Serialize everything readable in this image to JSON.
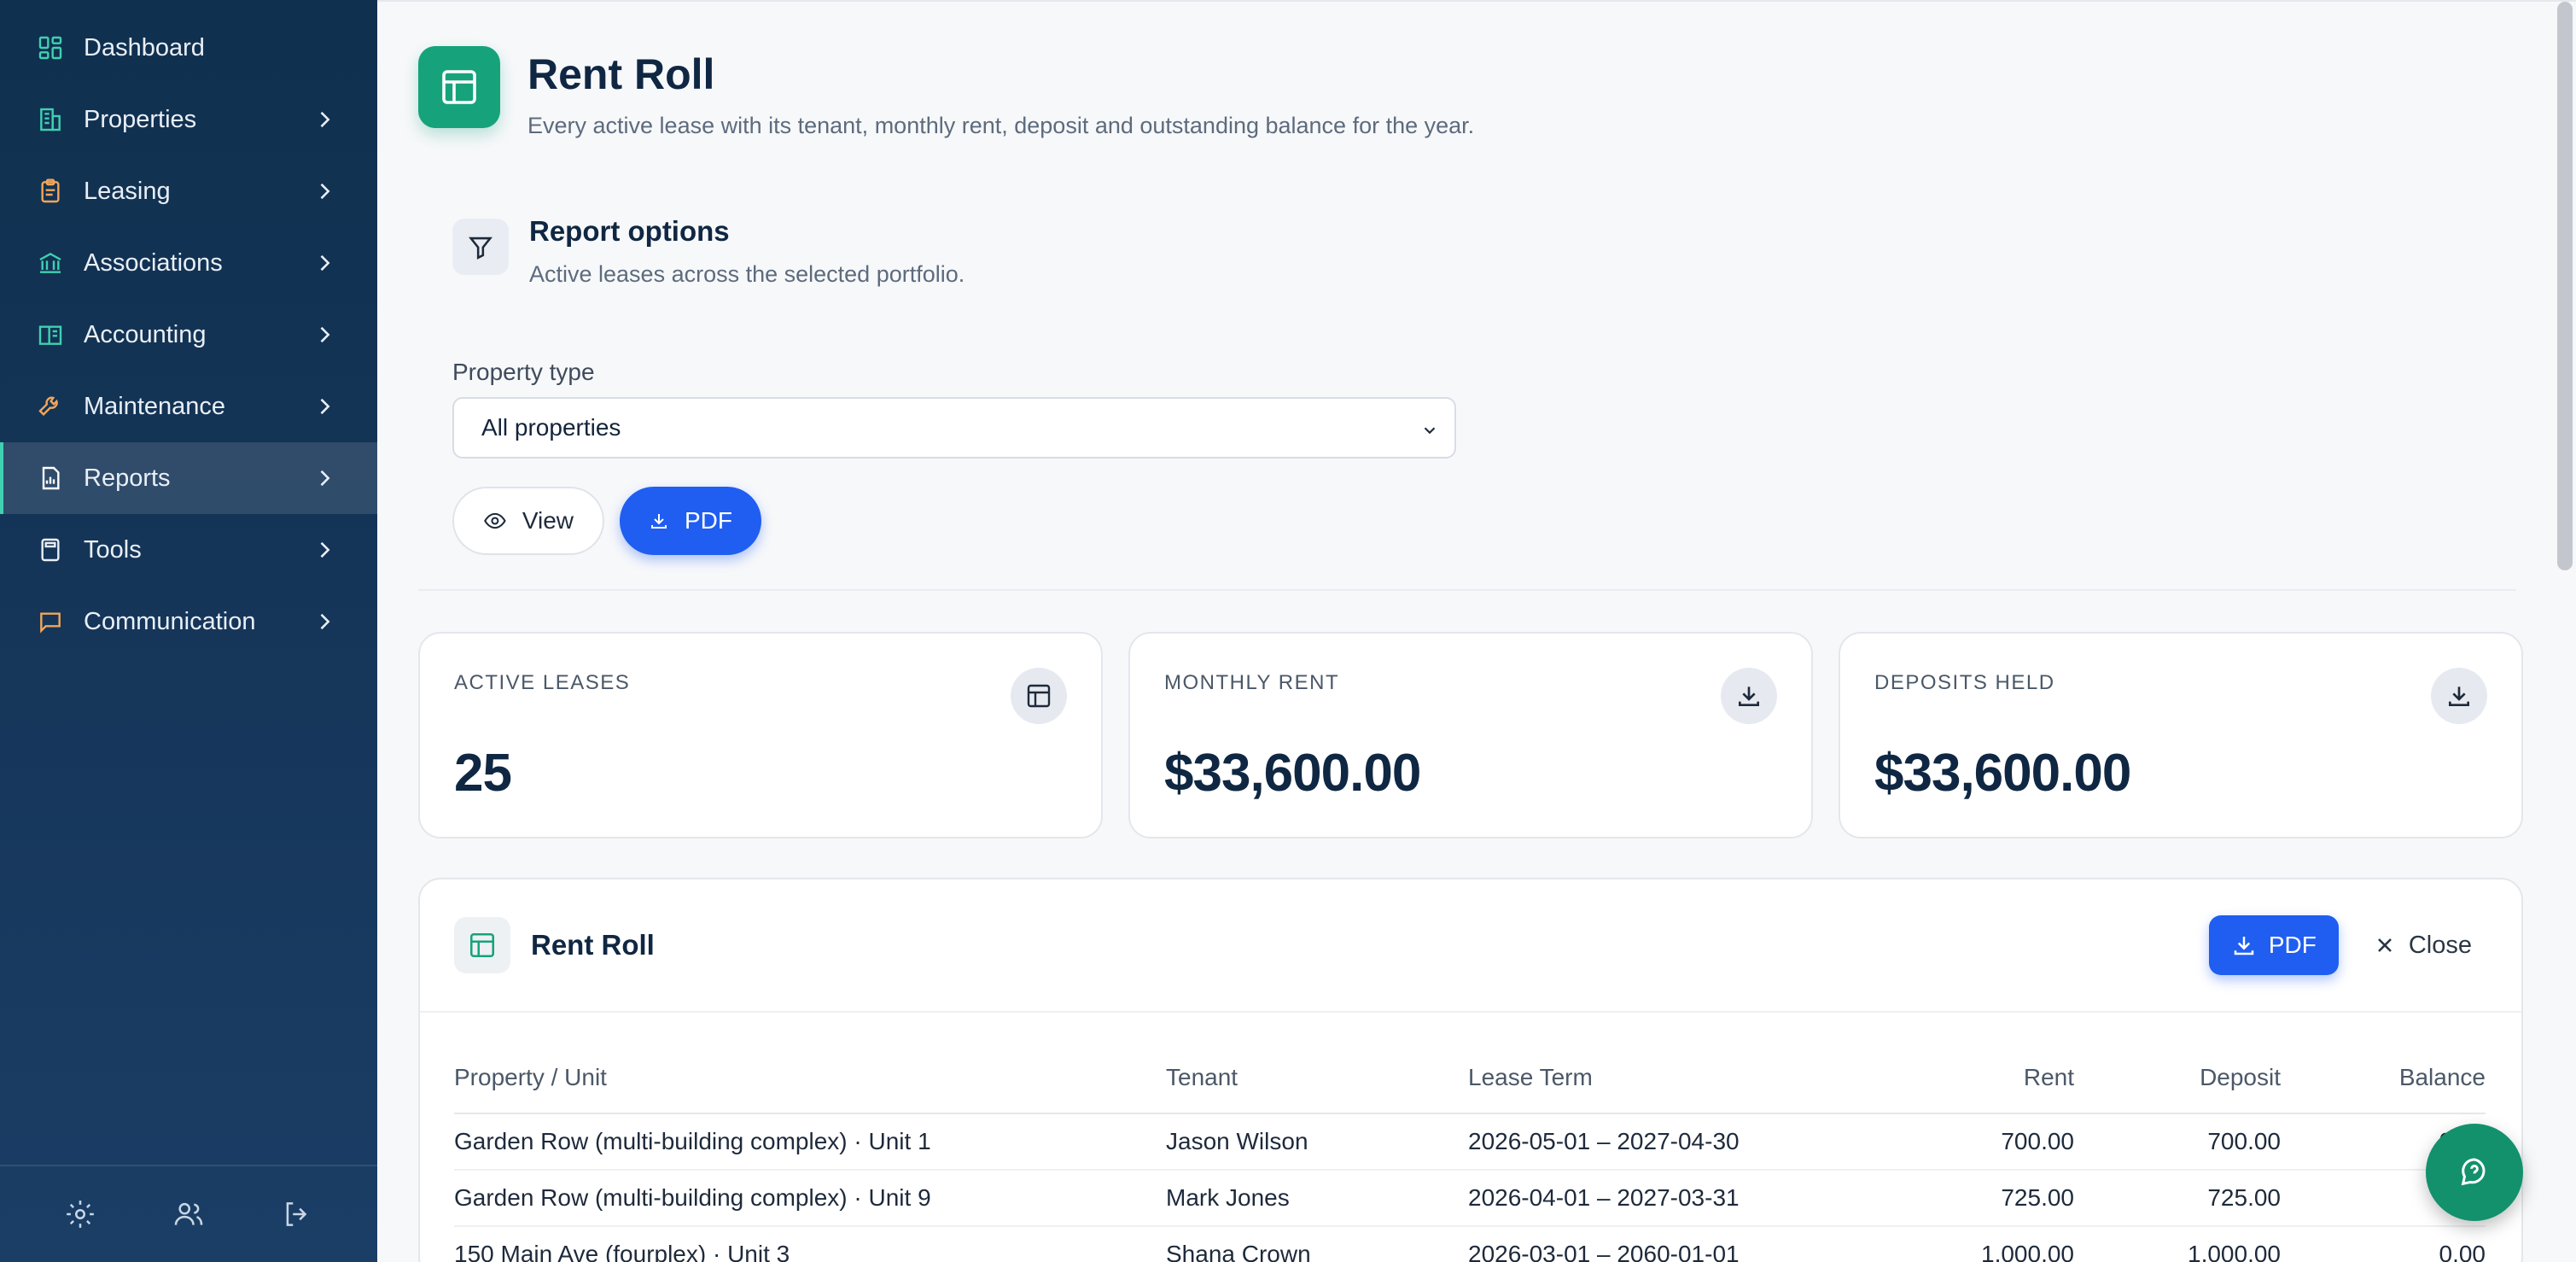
{
  "colors": {
    "sidebar_bg": "#14355a",
    "accent_green": "#16a37c",
    "primary_blue": "#1f5ef0",
    "active_indicator": "#3fd1b0"
  },
  "sidebar": {
    "items": [
      {
        "label": "Dashboard",
        "icon": "dashboard-icon",
        "has_children": false
      },
      {
        "label": "Properties",
        "icon": "building-icon",
        "has_children": true
      },
      {
        "label": "Leasing",
        "icon": "clipboard-icon",
        "has_children": true
      },
      {
        "label": "Associations",
        "icon": "bank-icon",
        "has_children": true
      },
      {
        "label": "Accounting",
        "icon": "ledger-icon",
        "has_children": true
      },
      {
        "label": "Maintenance",
        "icon": "wrench-icon",
        "has_children": true
      },
      {
        "label": "Reports",
        "icon": "report-icon",
        "has_children": true,
        "active": true
      },
      {
        "label": "Tools",
        "icon": "calculator-icon",
        "has_children": true
      },
      {
        "label": "Communication",
        "icon": "message-icon",
        "has_children": true
      }
    ],
    "footer": [
      "gear-icon",
      "users-icon",
      "logout-icon"
    ]
  },
  "page": {
    "title": "Rent Roll",
    "subtitle": "Every active lease with its tenant, monthly rent, deposit and outstanding balance for the year."
  },
  "options": {
    "title": "Report options",
    "subtitle": "Active leases across the selected portfolio.",
    "property_type_label": "Property type",
    "property_type_value": "All properties",
    "view_label": "View",
    "pdf_label": "PDF"
  },
  "stats": [
    {
      "label": "ACTIVE LEASES",
      "value": "25",
      "icon": "table-icon"
    },
    {
      "label": "MONTHLY RENT",
      "value": "$33,600.00",
      "icon": "download-icon"
    },
    {
      "label": "DEPOSITS HELD",
      "value": "$33,600.00",
      "icon": "download-icon"
    }
  ],
  "report": {
    "title": "Rent Roll",
    "pdf_label": "PDF",
    "close_label": "Close",
    "columns": [
      "Property / Unit",
      "Tenant",
      "Lease Term",
      "Rent",
      "Deposit",
      "Balance"
    ],
    "rows": [
      [
        "Garden Row (multi-building complex) · Unit 1",
        "Jason Wilson",
        "2026-05-01 – 2027-04-30",
        "700.00",
        "700.00",
        "0.00"
      ],
      [
        "Garden Row (multi-building complex) · Unit 9",
        "Mark Jones",
        "2026-04-01 – 2027-03-31",
        "725.00",
        "725.00",
        "0.00"
      ],
      [
        "150 Main Ave (fourplex) · Unit 3",
        "Shana Crown",
        "2026-03-01 – 2060-01-01",
        "1,000.00",
        "1,000.00",
        "0.00"
      ]
    ]
  }
}
